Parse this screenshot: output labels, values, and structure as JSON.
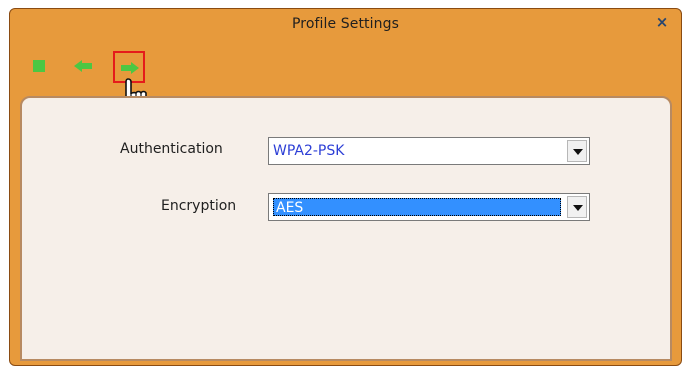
{
  "window": {
    "title": "Profile Settings",
    "close_icon": "×"
  },
  "toolbar": {
    "stop_icon": "stop-icon",
    "back_icon": "back-arrow-icon",
    "next_icon": "next-arrow-icon",
    "highlight_color": "#e51b1b"
  },
  "form": {
    "authentication_label": "Authentication",
    "authentication_value": "WPA2-PSK",
    "encryption_label": "Encryption",
    "encryption_value": "AES"
  },
  "colors": {
    "title_bar": "#e79a3c",
    "panel": "#f6efe9",
    "selection": "#3390ff",
    "icon_green": "#4cc743"
  }
}
